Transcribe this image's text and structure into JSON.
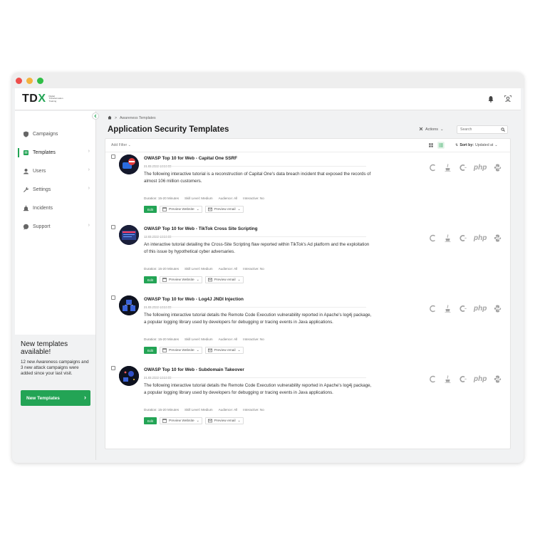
{
  "window": {
    "traffic_lights": [
      "close",
      "minimize",
      "maximize"
    ]
  },
  "brand": {
    "logo_main": "TD",
    "logo_x": "X",
    "logo_sub": "Digital Transformation Training"
  },
  "appbar": {
    "icons": [
      "bell-icon",
      "user-icon"
    ]
  },
  "sidebar": {
    "items": [
      {
        "label": "Campaigns",
        "icon": "shield-icon",
        "active": false,
        "has_chevron": false
      },
      {
        "label": "Templates",
        "icon": "templates-icon",
        "active": true,
        "has_chevron": true
      },
      {
        "label": "Users",
        "icon": "user-icon",
        "active": false,
        "has_chevron": true
      },
      {
        "label": "Settings",
        "icon": "wrench-icon",
        "active": false,
        "has_chevron": true
      },
      {
        "label": "Incidents",
        "icon": "alarm-icon",
        "active": false,
        "has_chevron": false
      },
      {
        "label": "Support",
        "icon": "chat-icon",
        "active": false,
        "has_chevron": true
      }
    ],
    "promo": {
      "title": "New templates available!",
      "text": "12 new Awareness campaigns and 3 new attack campaigns were added since your last visit.",
      "button": "New Templates"
    }
  },
  "breadcrumb": {
    "home_icon": "home-icon",
    "separator": ">",
    "current": "Awareness Templates"
  },
  "page": {
    "title": "Application Security Templates"
  },
  "toolbar": {
    "actions_label": "Actions",
    "search_placeholder": "Search"
  },
  "filters": {
    "add_filter": "Add Filter",
    "sort_label": "Sort by:",
    "sort_value": "Updated at"
  },
  "templates": [
    {
      "title": "OWASP Top 10 for Web - Capital One SSRF",
      "date": "21.03.2022 13:24:00",
      "description": "The following interactive tutorial is a reconstruction of Capital One's data breach incident that exposed the records of almost 106 million customers.",
      "duration": "Duration: 15-20 Minutes",
      "skill": "Skill Level: Medium",
      "audience": "Audience: All",
      "interactive": "Interactive: No"
    },
    {
      "title": "OWASP Top 10 for Web - TikTok Cross Site Scripting",
      "date": "12.03.2022 13:24:00",
      "description": "An interactive tutorial detailing the Cross-Site Scripting flaw reported within TikTok's Ad platform and the exploitation of this issue by hypothetical cyber adversaries.",
      "duration": "Duration: 15-20 Minutes",
      "skill": "Skill Level: Medium",
      "audience": "Audience: All",
      "interactive": "Interactive: No"
    },
    {
      "title": "OWASP Top 10 for Web - Log4J JNDI Injection",
      "date": "21.03.2022 13:24:00",
      "description": "The following interactive tutorial details the Remote Code Execution vulnerability reported in Apache's log4j package, a popular logging library used by developers for debugging or tracing events in Java applications.",
      "duration": "Duration: 15-20 Minutes",
      "skill": "Skill Level: Medium",
      "audience": "Audience: All",
      "interactive": "Interactive: No"
    },
    {
      "title": "OWASP Top 10 for Web - Subdomain Takeover",
      "date": "21.03.2022 13:24:00",
      "description": "The following interactive tutorial details the Remote Code Execution vulnerability reported in Apache's log4j package, a popular logging library used by developers for debugging or tracing events in Java applications.",
      "duration": "Duration: 15-20 Minutes",
      "skill": "Skill Level: Medium",
      "audience": "Audience: All",
      "interactive": "Interactive: No"
    }
  ],
  "row_buttons": {
    "edit": "Edit",
    "preview_website": "Preview Website",
    "preview_email": "Preview email"
  },
  "languages": {
    "php": "php",
    "icons": [
      "dotnet-icon",
      "java-icon",
      "cpp-icon",
      "php-icon",
      "python-icon"
    ]
  },
  "colors": {
    "accent": "#23a455"
  }
}
